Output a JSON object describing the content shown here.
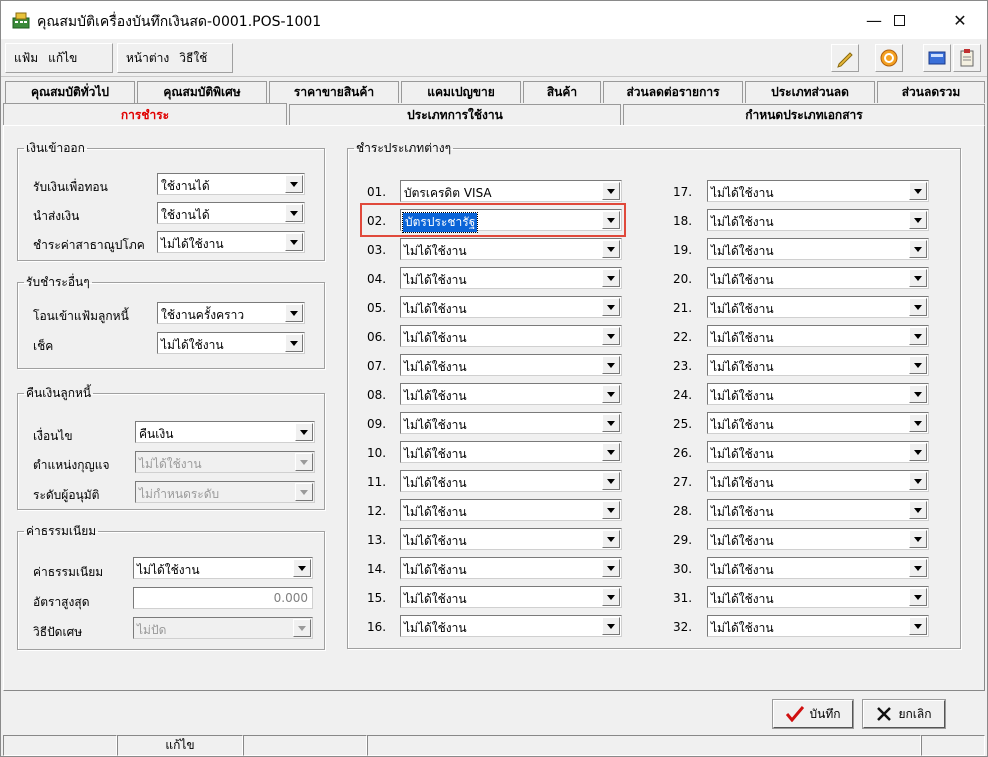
{
  "window": {
    "title": "คุณสมบัติเครื่องบันทึกเงินสด-0001.POS-1001"
  },
  "menu": {
    "file": "แฟ้ม",
    "edit": "แก้ไข",
    "window": "หน้าต่าง",
    "help": "วิธีใช้"
  },
  "icons": [
    "edit-pencil-icon",
    "refresh-icon",
    "calculator-icon",
    "clipboard-icon"
  ],
  "tabs_row1": [
    "คุณสมบัติทั่วไป",
    "คุณสมบัติพิเศษ",
    "ราคาขายสินค้า",
    "แคมเปญขาย",
    "สินค้า",
    "ส่วนลดต่อรายการ",
    "ประเภทส่วนลด",
    "ส่วนลดรวม"
  ],
  "tabs_row2": [
    "การชำระ",
    "ประเภทการใช้งาน",
    "กำหนดประเภทเอกสาร"
  ],
  "cash": {
    "title": "เงินเข้าออก",
    "rows": [
      {
        "label": "รับเงินเพื่อทอน",
        "value": "ใช้งานได้"
      },
      {
        "label": "นำส่งเงิน",
        "value": "ใช้งานได้"
      },
      {
        "label": "ชำระค่าสาธาณูปโภค",
        "value": "ไม่ได้ใช้งาน"
      }
    ]
  },
  "other_pay": {
    "title": "รับชำระอื่นๆ",
    "rows": [
      {
        "label": "โอนเข้าแฟ้มลูกหนี้",
        "value": "ใช้งานครั้งคราว"
      },
      {
        "label": "เช็ค",
        "value": "ไม่ได้ใช้งาน"
      }
    ]
  },
  "refund": {
    "title": "คืนเงินลูกหนี้",
    "rows": [
      {
        "label": "เงื่อนไข",
        "value": "คืนเงิน"
      },
      {
        "label": "ตำแหน่งกุญแจ",
        "value": "ไม่ได้ใช้งาน"
      },
      {
        "label": "ระดับผู้อนุมัติ",
        "value": "ไม่กำหนดระดับ"
      }
    ]
  },
  "fee": {
    "title": "ค่าธรรมเนียม",
    "rows": [
      {
        "label": "ค่าธรรมเนียม",
        "value": "ไม่ได้ใช้งาน"
      },
      {
        "label": "อัตราสูงสุด",
        "value": "0.000"
      },
      {
        "label": "วิธีปัดเศษ",
        "value": "ไม่ปัด"
      }
    ]
  },
  "payment_types": {
    "title": "ชำระประเภทต่างๆ",
    "items": [
      {
        "no": "01.",
        "value": "บัตรเครดิต VISA"
      },
      {
        "no": "02.",
        "value": "บัตรประชารัฐ"
      },
      {
        "no": "03.",
        "value": "ไม่ได้ใช้งาน"
      },
      {
        "no": "04.",
        "value": "ไม่ได้ใช้งาน"
      },
      {
        "no": "05.",
        "value": "ไม่ได้ใช้งาน"
      },
      {
        "no": "06.",
        "value": "ไม่ได้ใช้งาน"
      },
      {
        "no": "07.",
        "value": "ไม่ได้ใช้งาน"
      },
      {
        "no": "08.",
        "value": "ไม่ได้ใช้งาน"
      },
      {
        "no": "09.",
        "value": "ไม่ได้ใช้งาน"
      },
      {
        "no": "10.",
        "value": "ไม่ได้ใช้งาน"
      },
      {
        "no": "11.",
        "value": "ไม่ได้ใช้งาน"
      },
      {
        "no": "12.",
        "value": "ไม่ได้ใช้งาน"
      },
      {
        "no": "13.",
        "value": "ไม่ได้ใช้งาน"
      },
      {
        "no": "14.",
        "value": "ไม่ได้ใช้งาน"
      },
      {
        "no": "15.",
        "value": "ไม่ได้ใช้งาน"
      },
      {
        "no": "16.",
        "value": "ไม่ได้ใช้งาน"
      },
      {
        "no": "17.",
        "value": "ไม่ได้ใช้งาน"
      },
      {
        "no": "18.",
        "value": "ไม่ได้ใช้งาน"
      },
      {
        "no": "19.",
        "value": "ไม่ได้ใช้งาน"
      },
      {
        "no": "20.",
        "value": "ไม่ได้ใช้งาน"
      },
      {
        "no": "21.",
        "value": "ไม่ได้ใช้งาน"
      },
      {
        "no": "22.",
        "value": "ไม่ได้ใช้งาน"
      },
      {
        "no": "23.",
        "value": "ไม่ได้ใช้งาน"
      },
      {
        "no": "24.",
        "value": "ไม่ได้ใช้งาน"
      },
      {
        "no": "25.",
        "value": "ไม่ได้ใช้งาน"
      },
      {
        "no": "26.",
        "value": "ไม่ได้ใช้งาน"
      },
      {
        "no": "27.",
        "value": "ไม่ได้ใช้งาน"
      },
      {
        "no": "28.",
        "value": "ไม่ได้ใช้งาน"
      },
      {
        "no": "29.",
        "value": "ไม่ได้ใช้งาน"
      },
      {
        "no": "30.",
        "value": "ไม่ได้ใช้งาน"
      },
      {
        "no": "31.",
        "value": "ไม่ได้ใช้งาน"
      },
      {
        "no": "32.",
        "value": "ไม่ได้ใช้งาน"
      }
    ]
  },
  "buttons": {
    "save": "บันทึก",
    "cancel": "ยกเลิก"
  },
  "status": {
    "mode": "แก้ไข"
  },
  "colors": {
    "active_tab": "#e00000",
    "highlight_box": "#e0493b",
    "selection": "#0a64d8"
  }
}
